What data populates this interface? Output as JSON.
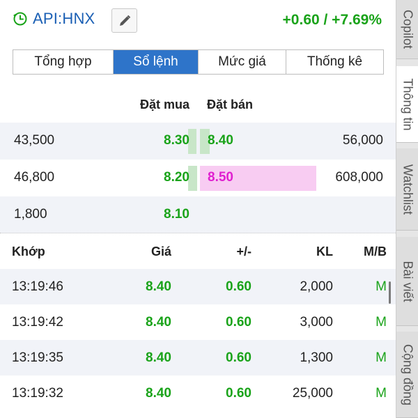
{
  "header": {
    "symbol": "API:HNX",
    "change": "+0.60 / +7.69%",
    "clock_icon": "clock-icon",
    "edit_icon": "pencil-icon"
  },
  "tabs": [
    {
      "label": "Tổng hợp",
      "active": false
    },
    {
      "label": "Sổ lệnh",
      "active": true
    },
    {
      "label": "Mức giá",
      "active": false
    },
    {
      "label": "Thống kê",
      "active": false
    }
  ],
  "orderbook": {
    "buy_header": "Đặt mua",
    "sell_header": "Đặt bán",
    "rows": [
      {
        "buy_vol": "43,500",
        "buy_price": "8.30",
        "sell_price": "8.40",
        "sell_vol": "56,000"
      },
      {
        "buy_vol": "46,800",
        "buy_price": "8.20",
        "sell_price": "8.50",
        "sell_vol": "608,000"
      },
      {
        "buy_vol": "1,800",
        "buy_price": "8.10",
        "sell_price": "",
        "sell_vol": ""
      }
    ]
  },
  "trades": {
    "headers": {
      "time": "Khớp",
      "price": "Giá",
      "change": "+/-",
      "volume": "KL",
      "side": "M/B"
    },
    "rows": [
      {
        "time": "13:19:46",
        "price": "8.40",
        "change": "0.60",
        "volume": "2,000",
        "side": "M"
      },
      {
        "time": "13:19:42",
        "price": "8.40",
        "change": "0.60",
        "volume": "3,000",
        "side": "M"
      },
      {
        "time": "13:19:35",
        "price": "8.40",
        "change": "0.60",
        "volume": "1,300",
        "side": "M"
      },
      {
        "time": "13:19:32",
        "price": "8.40",
        "change": "0.60",
        "volume": "25,000",
        "side": "M"
      }
    ]
  },
  "side_tabs": [
    {
      "label": "Copilot",
      "active": false
    },
    {
      "label": "Thông tin",
      "active": true
    },
    {
      "label": "Watchlist",
      "active": false
    },
    {
      "label": "Bài viết",
      "active": false
    },
    {
      "label": "Cộng đồng",
      "active": false
    }
  ],
  "colors": {
    "up": "#1aa31a",
    "ceiling": "#e020d0",
    "accent": "#2e74c9",
    "symbol": "#1a5fb4"
  }
}
